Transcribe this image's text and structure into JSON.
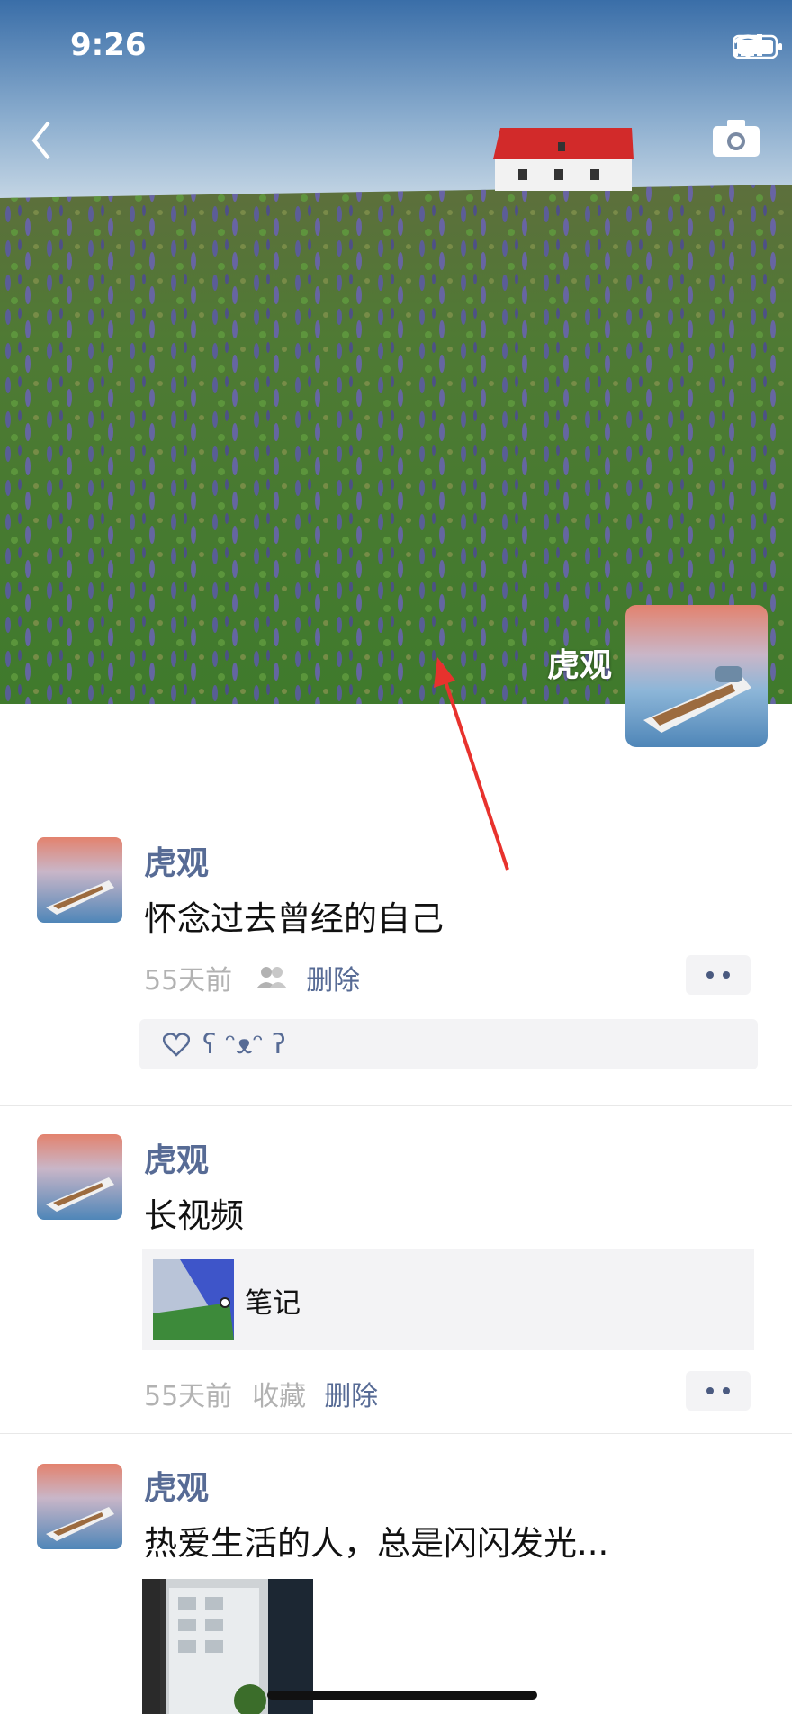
{
  "status_bar": {
    "time": "9:26"
  },
  "profile": {
    "username": "虎观"
  },
  "posts": [
    {
      "author": "虎观",
      "text": "怀念过去曾经的自己",
      "time": "55天前",
      "delete_label": "删除",
      "likes": "ʕ ᵔᴥᵔ ʔ"
    },
    {
      "author": "虎观",
      "text": "长视频",
      "link_title": "笔记",
      "time": "55天前",
      "favorite_label": "收藏",
      "delete_label": "删除"
    },
    {
      "author": "虎观",
      "text": "热爱生活的人，总是闪闪发光..."
    }
  ],
  "icons": [
    "back-icon",
    "camera-icon",
    "signal-icon",
    "wifi-icon",
    "battery-icon",
    "friends-visibility-icon",
    "heart-icon",
    "more-icon"
  ],
  "colors": {
    "link_blue": "#576b95",
    "meta_gray": "#b2b2b2",
    "panel_bg": "#f3f3f5",
    "annotation_arrow": "#e8322d"
  }
}
